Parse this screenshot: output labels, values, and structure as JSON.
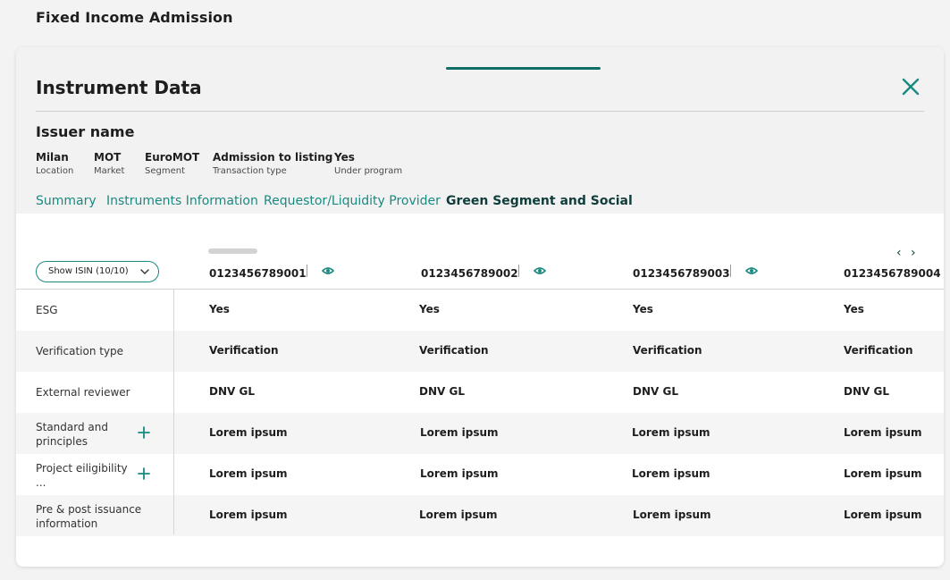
{
  "page": {
    "title": "Fixed Income Admission"
  },
  "panel": {
    "title": "Instrument Data",
    "close_icon": "close-icon",
    "issuer": "Issuer name",
    "meta": [
      {
        "value": "Milan",
        "label": "Location"
      },
      {
        "value": "MOT",
        "label": "Market"
      },
      {
        "value": "EuroMOT",
        "label": "Segment"
      },
      {
        "value": "Admission to listing",
        "label": "Transaction type"
      },
      {
        "value": "Yes",
        "label": "Under program"
      }
    ],
    "tabs": [
      {
        "label": "Summary"
      },
      {
        "label": "Instruments Information"
      },
      {
        "label": "Requestor/Liquidity Provider"
      },
      {
        "label": "Green Segment and Social",
        "active": true
      }
    ]
  },
  "table": {
    "show_isin_label": "Show  ISIN (10/10)",
    "nav": {
      "prev": "‹",
      "next": "›"
    },
    "isins": [
      "0123456789001",
      "0123456789002",
      "0123456789003",
      "0123456789004"
    ],
    "rows": [
      {
        "label": "ESG",
        "values": [
          "Yes",
          "Yes",
          "Yes",
          "Yes"
        ]
      },
      {
        "label": "Verification type",
        "values": [
          "Verification",
          "Verification",
          "Verification",
          "Verification"
        ]
      },
      {
        "label": "External reviewer",
        "values": [
          "DNV GL",
          "DNV GL",
          "DNV GL",
          "DNV GL"
        ]
      },
      {
        "label": "Standard and principles",
        "expandable": true,
        "values": [
          "Lorem ipsum",
          "Lorem ipsum",
          "Lorem ipsum",
          "Lorem ipsum"
        ]
      },
      {
        "label": "Project eiligibility ...",
        "expandable": true,
        "values": [
          "Lorem ipsum",
          "Lorem ipsum",
          "Lorem ipsum",
          "Lorem ipsum"
        ]
      },
      {
        "label": "Pre & post issuance information",
        "values": [
          "Lorem ipsum",
          "Lorem ipsum",
          "Lorem ipsum",
          "Lorem ipsum"
        ]
      }
    ]
  },
  "colors": {
    "accent": "#1a8a80",
    "dark_accent": "#0f3d3b",
    "background": "#f3f3f3"
  }
}
